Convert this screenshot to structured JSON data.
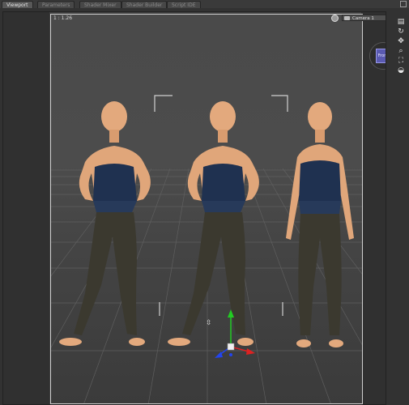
{
  "tabs": [
    {
      "label": "Viewport",
      "active": true
    },
    {
      "label": "Parameters",
      "active": false
    },
    {
      "label": "Shader Mixer",
      "active": false
    },
    {
      "label": "Shader Builder",
      "active": false
    },
    {
      "label": "Script IDE",
      "active": false
    }
  ],
  "viewport": {
    "aspect_label": "1 : 1.26",
    "camera": "Camera 1",
    "cube_face": "Front"
  },
  "nav_icons": [
    "camera-icon",
    "orbit-icon",
    "pan-icon",
    "zoom-icon",
    "frame-icon",
    "reset-icon"
  ],
  "colors": {
    "skin": "#e0a67a",
    "corset": "#1e2f4e",
    "pants": "#3a382f",
    "grid": "#5c5c5c",
    "frame_border": "#cfcfcf",
    "cube_face": "#5a5ab2"
  }
}
